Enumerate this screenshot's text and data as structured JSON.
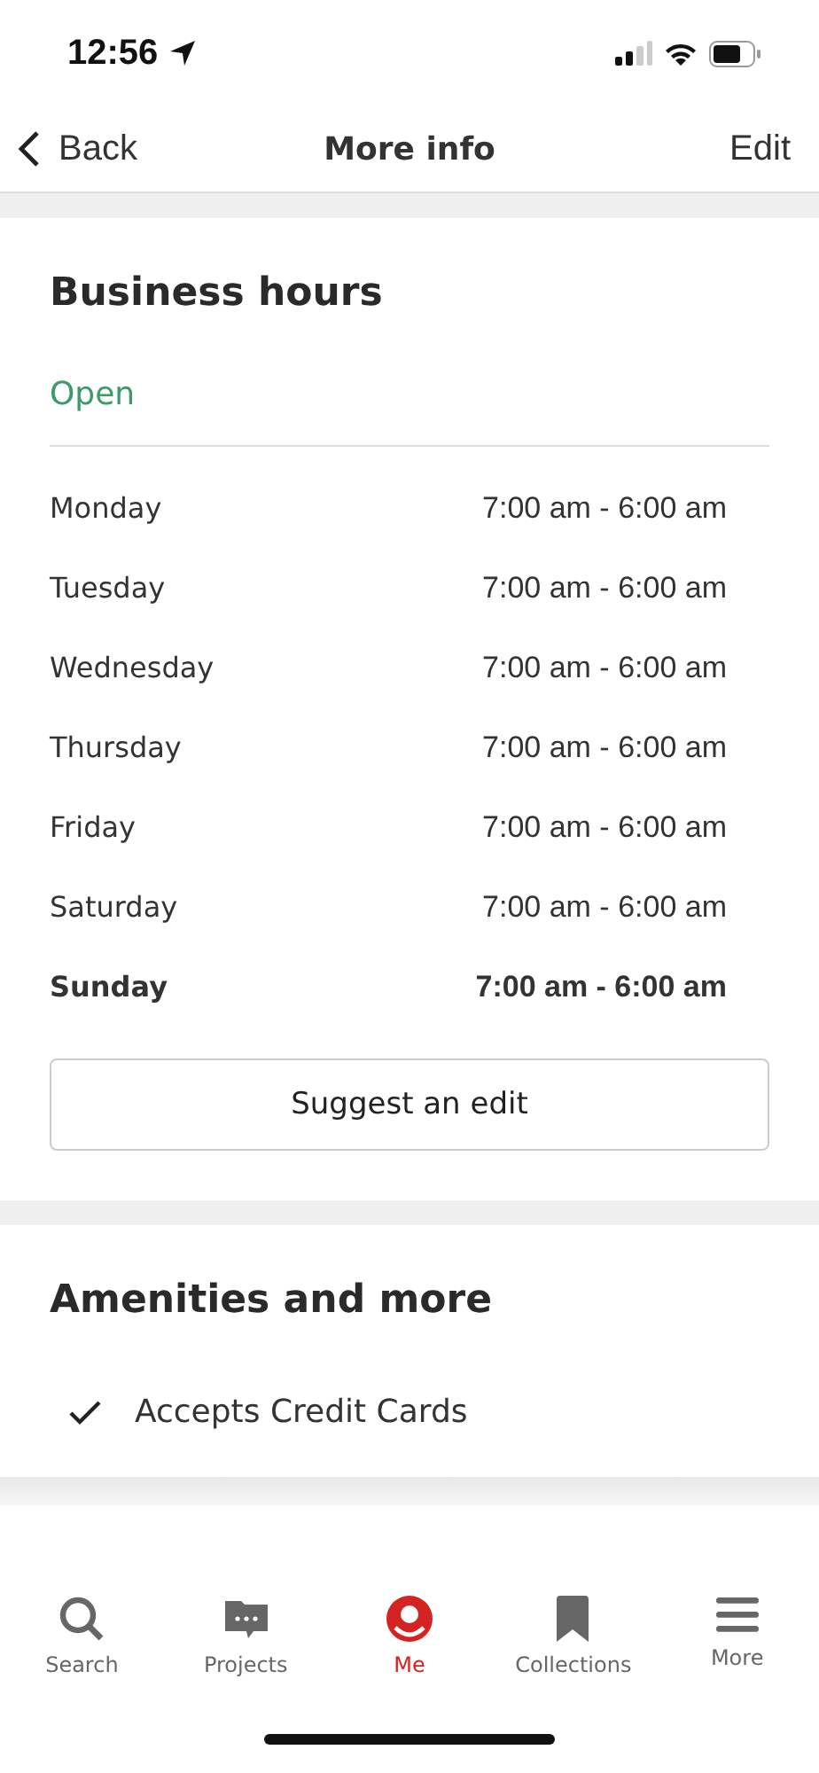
{
  "status_bar": {
    "time": "12:56"
  },
  "nav": {
    "back": "Back",
    "title": "More info",
    "action": "Edit"
  },
  "business_hours": {
    "title": "Business hours",
    "status": "Open",
    "days": [
      {
        "day": "Monday",
        "hours": "7:00 am - 6:00 am",
        "today": false
      },
      {
        "day": "Tuesday",
        "hours": "7:00 am - 6:00 am",
        "today": false
      },
      {
        "day": "Wednesday",
        "hours": "7:00 am - 6:00 am",
        "today": false
      },
      {
        "day": "Thursday",
        "hours": "7:00 am - 6:00 am",
        "today": false
      },
      {
        "day": "Friday",
        "hours": "7:00 am - 6:00 am",
        "today": false
      },
      {
        "day": "Saturday",
        "hours": "7:00 am - 6:00 am",
        "today": false
      },
      {
        "day": "Sunday",
        "hours": "7:00 am - 6:00 am",
        "today": true
      }
    ],
    "button": "Suggest an edit"
  },
  "amenities": {
    "title": "Amenities and more",
    "items": [
      {
        "label": "Accepts Credit Cards",
        "checked": true
      }
    ]
  },
  "tab_bar": [
    {
      "label": "Search",
      "kind": "search",
      "selected": false
    },
    {
      "label": "Projects",
      "kind": "projects",
      "selected": false
    },
    {
      "label": "Me",
      "kind": "me",
      "selected": true
    },
    {
      "label": "Collections",
      "kind": "collections",
      "selected": false
    },
    {
      "label": "More",
      "kind": "more",
      "selected": false
    }
  ]
}
